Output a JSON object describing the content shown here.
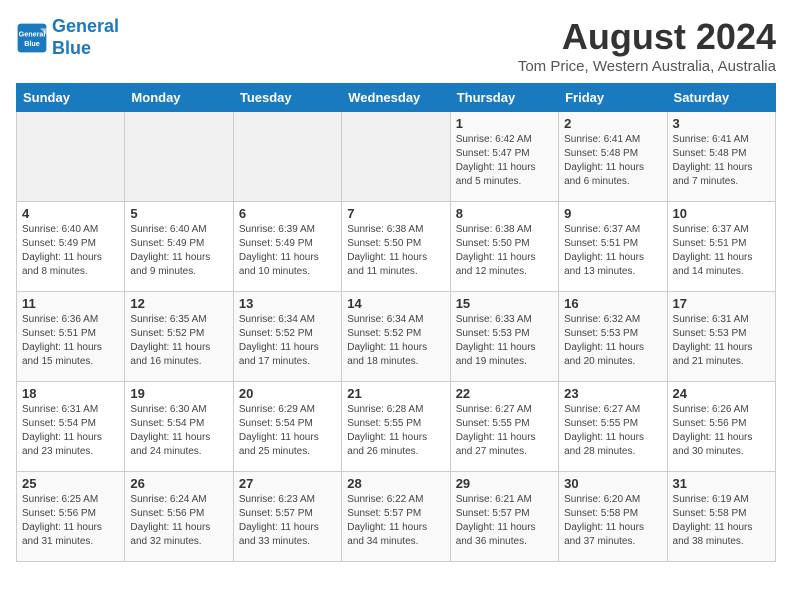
{
  "header": {
    "logo_line1": "General",
    "logo_line2": "Blue",
    "title": "August 2024",
    "subtitle": "Tom Price, Western Australia, Australia"
  },
  "columns": [
    "Sunday",
    "Monday",
    "Tuesday",
    "Wednesday",
    "Thursday",
    "Friday",
    "Saturday"
  ],
  "weeks": [
    [
      {
        "day": "",
        "info": ""
      },
      {
        "day": "",
        "info": ""
      },
      {
        "day": "",
        "info": ""
      },
      {
        "day": "",
        "info": ""
      },
      {
        "day": "1",
        "info": "Sunrise: 6:42 AM\nSunset: 5:47 PM\nDaylight: 11 hours and 5 minutes."
      },
      {
        "day": "2",
        "info": "Sunrise: 6:41 AM\nSunset: 5:48 PM\nDaylight: 11 hours and 6 minutes."
      },
      {
        "day": "3",
        "info": "Sunrise: 6:41 AM\nSunset: 5:48 PM\nDaylight: 11 hours and 7 minutes."
      }
    ],
    [
      {
        "day": "4",
        "info": "Sunrise: 6:40 AM\nSunset: 5:49 PM\nDaylight: 11 hours and 8 minutes."
      },
      {
        "day": "5",
        "info": "Sunrise: 6:40 AM\nSunset: 5:49 PM\nDaylight: 11 hours and 9 minutes."
      },
      {
        "day": "6",
        "info": "Sunrise: 6:39 AM\nSunset: 5:49 PM\nDaylight: 11 hours and 10 minutes."
      },
      {
        "day": "7",
        "info": "Sunrise: 6:38 AM\nSunset: 5:50 PM\nDaylight: 11 hours and 11 minutes."
      },
      {
        "day": "8",
        "info": "Sunrise: 6:38 AM\nSunset: 5:50 PM\nDaylight: 11 hours and 12 minutes."
      },
      {
        "day": "9",
        "info": "Sunrise: 6:37 AM\nSunset: 5:51 PM\nDaylight: 11 hours and 13 minutes."
      },
      {
        "day": "10",
        "info": "Sunrise: 6:37 AM\nSunset: 5:51 PM\nDaylight: 11 hours and 14 minutes."
      }
    ],
    [
      {
        "day": "11",
        "info": "Sunrise: 6:36 AM\nSunset: 5:51 PM\nDaylight: 11 hours and 15 minutes."
      },
      {
        "day": "12",
        "info": "Sunrise: 6:35 AM\nSunset: 5:52 PM\nDaylight: 11 hours and 16 minutes."
      },
      {
        "day": "13",
        "info": "Sunrise: 6:34 AM\nSunset: 5:52 PM\nDaylight: 11 hours and 17 minutes."
      },
      {
        "day": "14",
        "info": "Sunrise: 6:34 AM\nSunset: 5:52 PM\nDaylight: 11 hours and 18 minutes."
      },
      {
        "day": "15",
        "info": "Sunrise: 6:33 AM\nSunset: 5:53 PM\nDaylight: 11 hours and 19 minutes."
      },
      {
        "day": "16",
        "info": "Sunrise: 6:32 AM\nSunset: 5:53 PM\nDaylight: 11 hours and 20 minutes."
      },
      {
        "day": "17",
        "info": "Sunrise: 6:31 AM\nSunset: 5:53 PM\nDaylight: 11 hours and 21 minutes."
      }
    ],
    [
      {
        "day": "18",
        "info": "Sunrise: 6:31 AM\nSunset: 5:54 PM\nDaylight: 11 hours and 23 minutes."
      },
      {
        "day": "19",
        "info": "Sunrise: 6:30 AM\nSunset: 5:54 PM\nDaylight: 11 hours and 24 minutes."
      },
      {
        "day": "20",
        "info": "Sunrise: 6:29 AM\nSunset: 5:54 PM\nDaylight: 11 hours and 25 minutes."
      },
      {
        "day": "21",
        "info": "Sunrise: 6:28 AM\nSunset: 5:55 PM\nDaylight: 11 hours and 26 minutes."
      },
      {
        "day": "22",
        "info": "Sunrise: 6:27 AM\nSunset: 5:55 PM\nDaylight: 11 hours and 27 minutes."
      },
      {
        "day": "23",
        "info": "Sunrise: 6:27 AM\nSunset: 5:55 PM\nDaylight: 11 hours and 28 minutes."
      },
      {
        "day": "24",
        "info": "Sunrise: 6:26 AM\nSunset: 5:56 PM\nDaylight: 11 hours and 30 minutes."
      }
    ],
    [
      {
        "day": "25",
        "info": "Sunrise: 6:25 AM\nSunset: 5:56 PM\nDaylight: 11 hours and 31 minutes."
      },
      {
        "day": "26",
        "info": "Sunrise: 6:24 AM\nSunset: 5:56 PM\nDaylight: 11 hours and 32 minutes."
      },
      {
        "day": "27",
        "info": "Sunrise: 6:23 AM\nSunset: 5:57 PM\nDaylight: 11 hours and 33 minutes."
      },
      {
        "day": "28",
        "info": "Sunrise: 6:22 AM\nSunset: 5:57 PM\nDaylight: 11 hours and 34 minutes."
      },
      {
        "day": "29",
        "info": "Sunrise: 6:21 AM\nSunset: 5:57 PM\nDaylight: 11 hours and 36 minutes."
      },
      {
        "day": "30",
        "info": "Sunrise: 6:20 AM\nSunset: 5:58 PM\nDaylight: 11 hours and 37 minutes."
      },
      {
        "day": "31",
        "info": "Sunrise: 6:19 AM\nSunset: 5:58 PM\nDaylight: 11 hours and 38 minutes."
      }
    ]
  ]
}
